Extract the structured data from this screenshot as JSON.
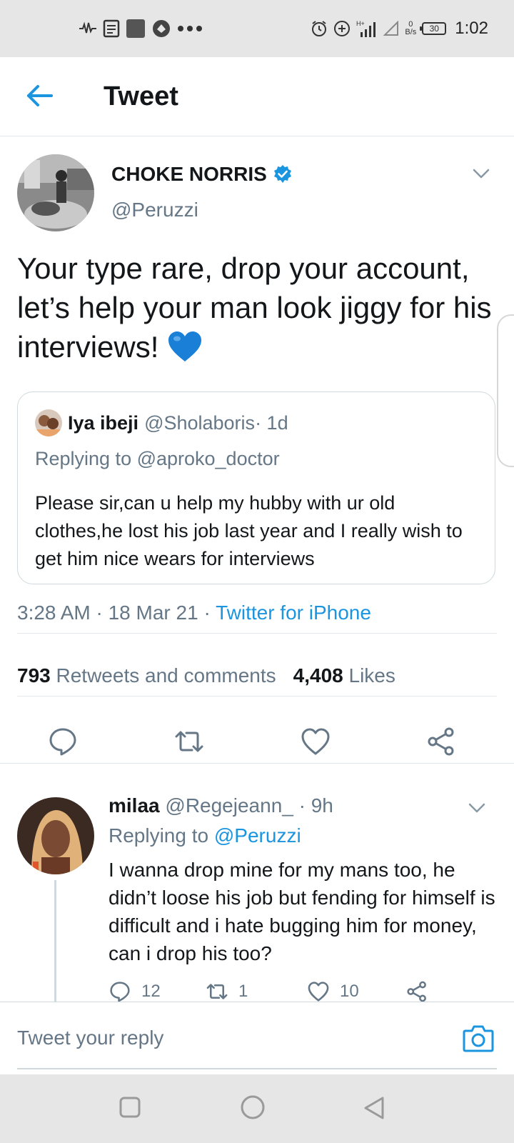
{
  "status_bar": {
    "time": "1:02",
    "battery": "30",
    "net_speed_value": "0",
    "net_speed_unit": "B/s",
    "left_icons": [
      "waveform-icon",
      "document-icon",
      "square-app-icon",
      "vpn-icon",
      "more-dots-icon"
    ],
    "right_icons": [
      "alarm-icon",
      "data-saver-icon",
      "signal-icon",
      "signal-empty-icon",
      "battery-icon"
    ]
  },
  "header": {
    "title": "Tweet",
    "back_icon": "back-arrow-icon"
  },
  "tweet": {
    "author_name": "CHOKE NORRIS",
    "verified": true,
    "handle": "@Peruzzi",
    "text": "Your type rare, drop your account, let’s help your man look jiggy for his interviews!",
    "emoji": "blue-heart",
    "quote": {
      "name": "Iya ibeji",
      "handle": "@Sholaboris",
      "time": " · 1d",
      "replying": "Replying to @aproko_doctor",
      "text": "Please sir,can u help my hubby with ur old clothes,he lost his job last year and I really wish to get him nice wears for interviews"
    },
    "timestamp": "3:28 AM · 18 Mar 21 · ",
    "source": "Twitter for iPhone",
    "retweets_count": "793",
    "retweets_label": "Retweets and comments",
    "likes_count": "4,408",
    "likes_label": "Likes"
  },
  "reply": {
    "name": "milaa",
    "handle_time": " @Regejeann_ · 9h",
    "replying_prefix": "Replying to ",
    "replying_to": "@Peruzzi",
    "text": "I wanna drop mine for my mans too, he didn’t loose his job but fending for himself is difficult and i hate bugging him for money, can i drop his too?",
    "comments": "12",
    "retweets": "1",
    "likes": "10"
  },
  "composer": {
    "placeholder": "Tweet your reply"
  },
  "colors": {
    "accent": "#1b95e0",
    "muted": "#657786",
    "text": "#14171a",
    "divider": "#e1e8ed"
  }
}
